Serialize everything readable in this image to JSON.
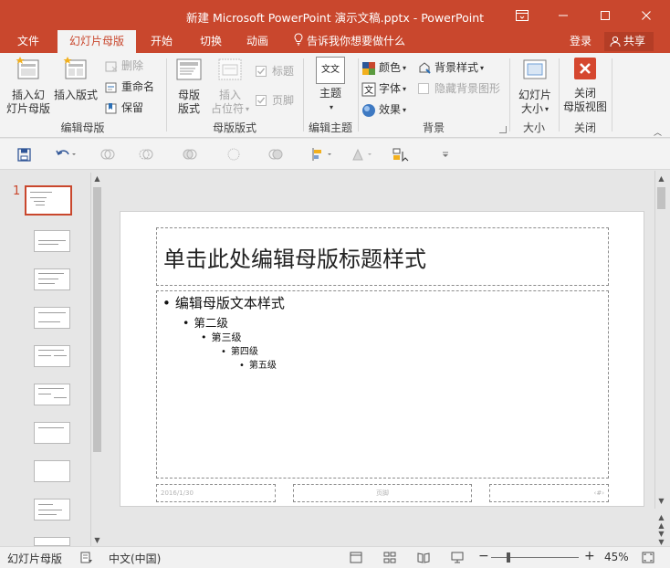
{
  "window": {
    "title": "新建 Microsoft PowerPoint 演示文稿.pptx - PowerPoint",
    "controls": [
      "ribbon-display-icon",
      "minimize-icon",
      "maximize-icon",
      "close-icon"
    ]
  },
  "tabs": [
    {
      "label": "文件",
      "active": false
    },
    {
      "label": "幻灯片母版",
      "active": true
    },
    {
      "label": "开始",
      "active": false
    },
    {
      "label": "切换",
      "active": false
    },
    {
      "label": "动画",
      "active": false
    }
  ],
  "tell_me": "告诉我你想要做什么",
  "account": {
    "login": "登录",
    "share": "共享"
  },
  "ribbon": {
    "edit_master": {
      "label": "编辑母版",
      "insert_slide_master": [
        "插入幻",
        "灯片母版"
      ],
      "insert_layout": "插入版式",
      "delete": "删除",
      "rename": "重命名",
      "preserve": "保留"
    },
    "master_layout": {
      "label": "母版版式",
      "master_layout_btn": [
        "母版",
        "版式"
      ],
      "insert_placeholder": [
        "插入",
        "占位符"
      ],
      "title_check": "标题",
      "footer_check": "页脚"
    },
    "edit_theme": {
      "label": "编辑主题",
      "themes": "主题",
      "theme_icon_text": "文文"
    },
    "background": {
      "label": "背景",
      "colors": "颜色",
      "fonts": "字体",
      "effects": "效果",
      "bg_styles": "背景样式",
      "hide_bg": "隐藏背景图形"
    },
    "size": {
      "label": "大小",
      "slide_size": [
        "幻灯片",
        "大小"
      ]
    },
    "close": {
      "label": "关闭",
      "close_master": [
        "关闭",
        "母版视图"
      ]
    }
  },
  "thumbnails": {
    "selected_number": "1"
  },
  "slide": {
    "title": "单击此处编辑母版标题样式",
    "levels": [
      "编辑母版文本样式",
      "第二级",
      "第三级",
      "第四级",
      "第五级"
    ],
    "footer_date": "2016/1/30",
    "footer_text": "页脚",
    "footer_num": "‹#›"
  },
  "status": {
    "view": "幻灯片母版",
    "language": "中文(中国)",
    "zoom": "45%",
    "zoom_fraction": 0.45
  },
  "colors": {
    "accent": "#c9472d"
  }
}
